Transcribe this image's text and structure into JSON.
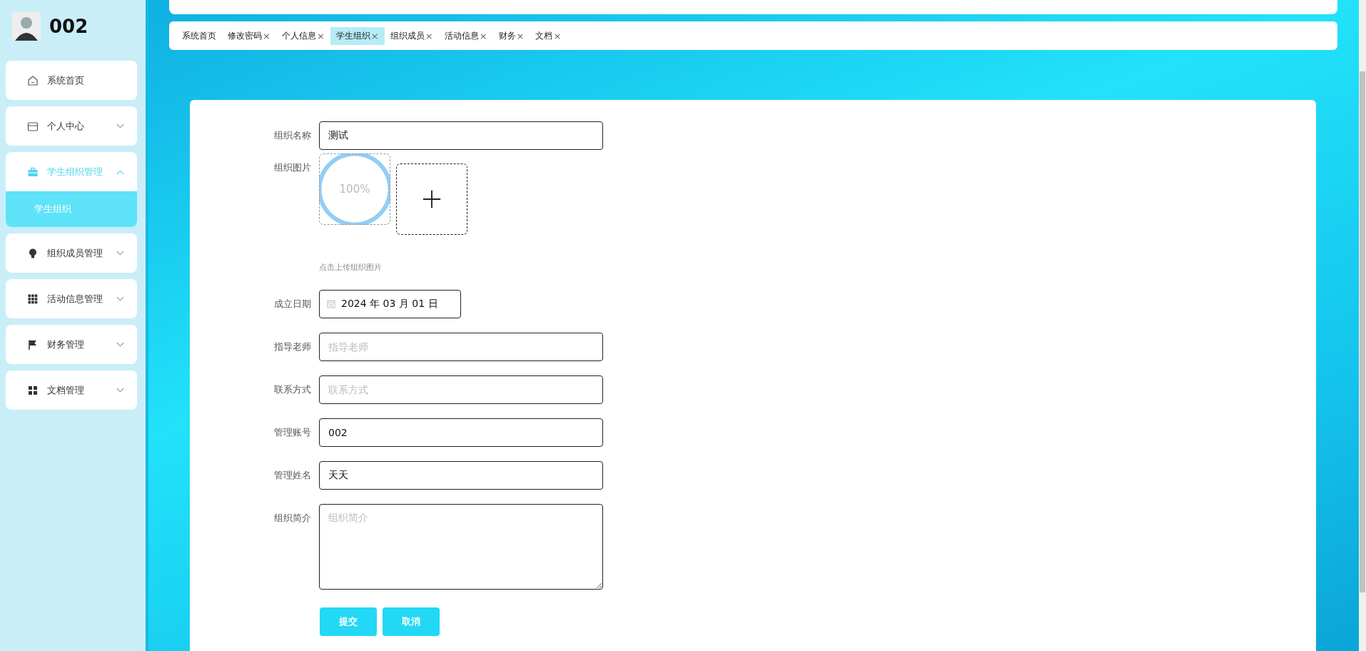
{
  "user": {
    "name": "002"
  },
  "menu": [
    {
      "label": "系统首页"
    },
    {
      "label": "个人中心",
      "expanded": false
    },
    {
      "label": "学生组织管理",
      "expanded": true,
      "children": [
        {
          "label": "学生组织",
          "selected": true
        }
      ]
    },
    {
      "label": "组织成员管理",
      "expanded": false
    },
    {
      "label": "活动信息管理",
      "expanded": false
    },
    {
      "label": "财务管理",
      "expanded": false
    },
    {
      "label": "文档管理",
      "expanded": false
    }
  ],
  "tabs": [
    {
      "label": "系统首页",
      "selected": false
    },
    {
      "label": "修改密码",
      "close": "×",
      "selected": false
    },
    {
      "label": "个人信息",
      "close": "×",
      "selected": false
    },
    {
      "label": "学生组织",
      "close": "×",
      "selected": true
    },
    {
      "label": "组织成员",
      "close": "×",
      "selected": false
    },
    {
      "label": "活动信息",
      "close": "×",
      "selected": false
    },
    {
      "label": "财务",
      "close": "×",
      "selected": false
    },
    {
      "label": "文档",
      "close": "×",
      "selected": false
    }
  ],
  "form": {
    "fields": [
      {
        "kind": "text",
        "label": "组织名称",
        "value": "测试"
      },
      {
        "kind": "upload",
        "label": "组织图片",
        "progress": "100%",
        "hint": "点击上传组织图片"
      },
      {
        "kind": "date",
        "label": "成立日期",
        "value": "2024 年 03 月 01 日"
      },
      {
        "kind": "text",
        "label": "指导老师",
        "placeholder": "指导老师"
      },
      {
        "kind": "text",
        "label": "联系方式",
        "placeholder": "联系方式"
      },
      {
        "kind": "text",
        "label": "管理账号",
        "value": "002"
      },
      {
        "kind": "text",
        "label": "管理姓名",
        "value": "天天"
      },
      {
        "kind": "textarea",
        "label": "组织简介",
        "placeholder": "组织简介"
      }
    ],
    "buttons": [
      "提交",
      "取消"
    ]
  }
}
